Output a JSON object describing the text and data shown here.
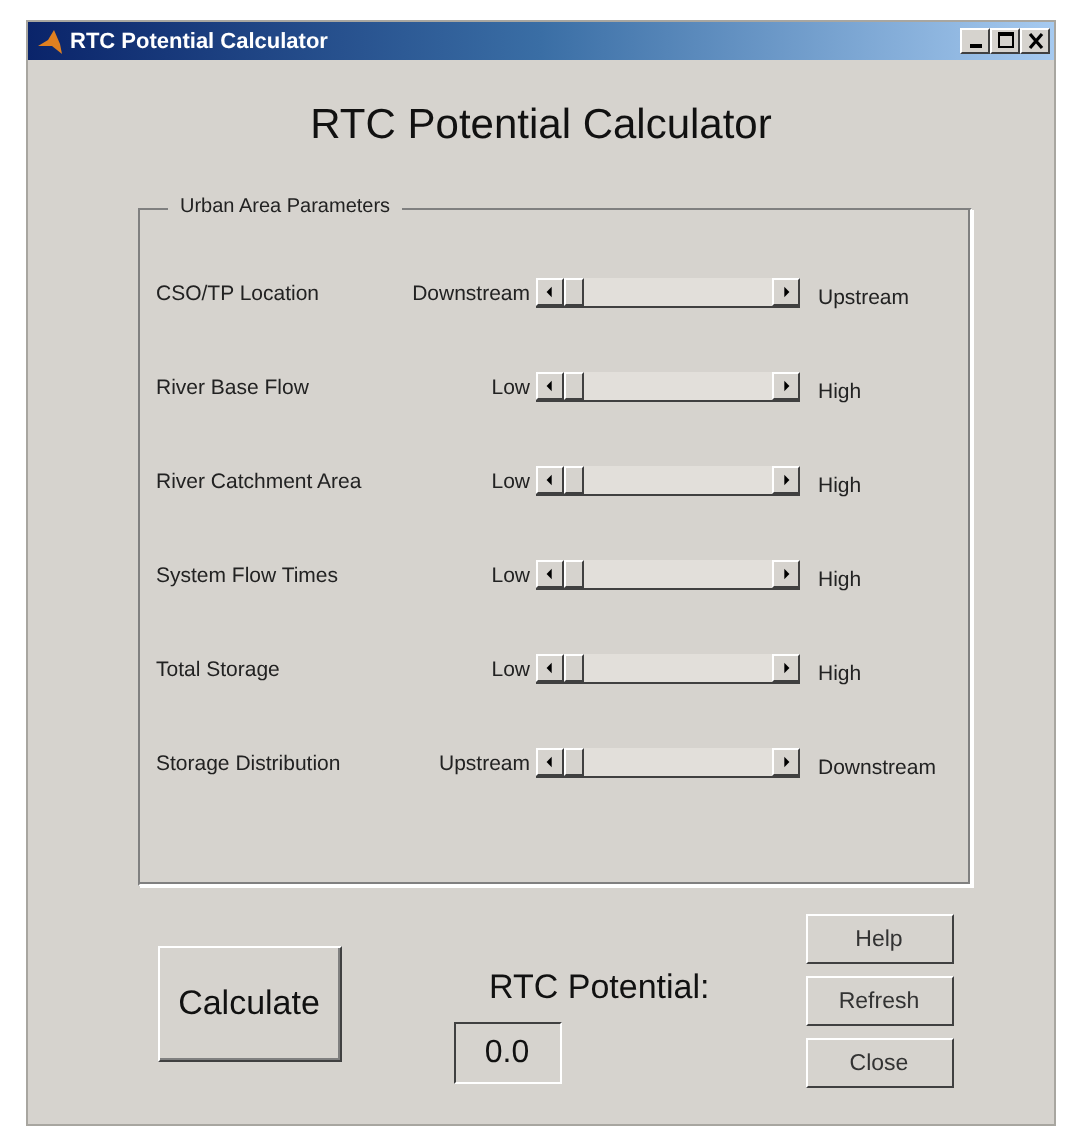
{
  "window": {
    "title": "RTC Potential Calculator"
  },
  "heading": "RTC Potential Calculator",
  "group": {
    "title": "Urban Area Parameters",
    "sliders": [
      {
        "label": "CSO/TP Location",
        "min_label": "Downstream",
        "max_label": "Upstream",
        "level": 0
      },
      {
        "label": "River Base Flow",
        "min_label": "Low",
        "max_label": "High",
        "level": 0
      },
      {
        "label": "River Catchment Area",
        "min_label": "Low",
        "max_label": "High",
        "level": 0
      },
      {
        "label": "System Flow Times",
        "min_label": "Low",
        "max_label": "High",
        "level": 0
      },
      {
        "label": "Total Storage",
        "min_label": "Low",
        "max_label": "High",
        "level": 0
      },
      {
        "label": "Storage Distribution",
        "min_label": "Upstream",
        "max_label": "Downstream",
        "level": 0
      }
    ]
  },
  "calculate_button": "Calculate",
  "result": {
    "label": "RTC Potential:",
    "value": "0.0"
  },
  "side_buttons": [
    "Help",
    "Refresh",
    "Close"
  ]
}
